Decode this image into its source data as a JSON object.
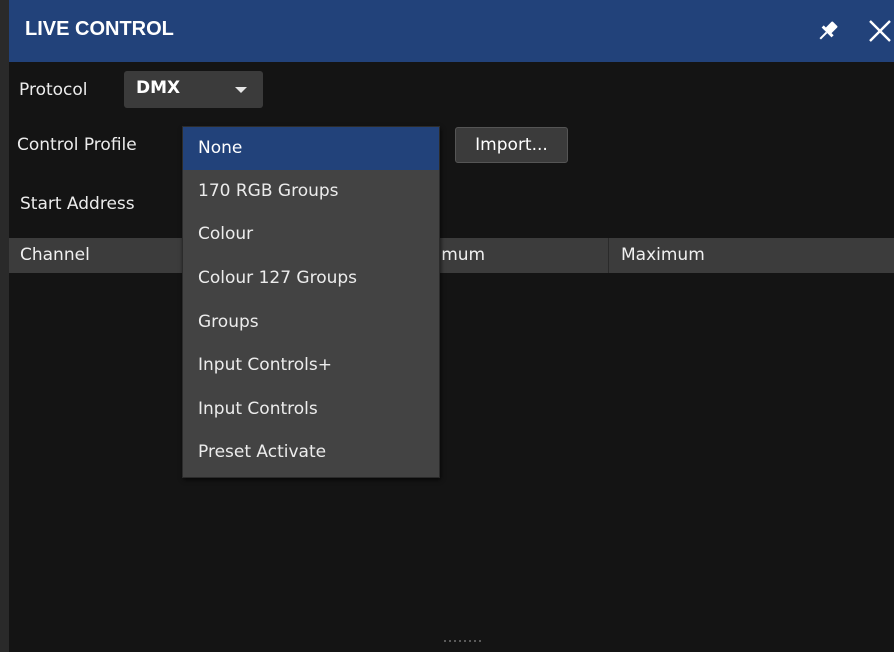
{
  "window": {
    "title": "LIVE CONTROL",
    "title_bar_color": "#22427a",
    "pin_icon": "pin-icon",
    "close_icon": "close-icon"
  },
  "protocol": {
    "label": "Protocol",
    "value": "DMX"
  },
  "control_profile": {
    "label": "Control Profile",
    "import_label": "Import...",
    "dropdown_options": [
      "None",
      "170 RGB Groups",
      "Colour",
      "Colour 127 Groups",
      "Groups",
      "Input Controls+",
      "Input Controls",
      "Preset Activate"
    ],
    "selected_index": 0,
    "selection_color": "#22427a"
  },
  "start_address": {
    "label": "Start Address"
  },
  "table": {
    "columns": [
      "Channel",
      "inimum",
      "Maximum"
    ]
  }
}
